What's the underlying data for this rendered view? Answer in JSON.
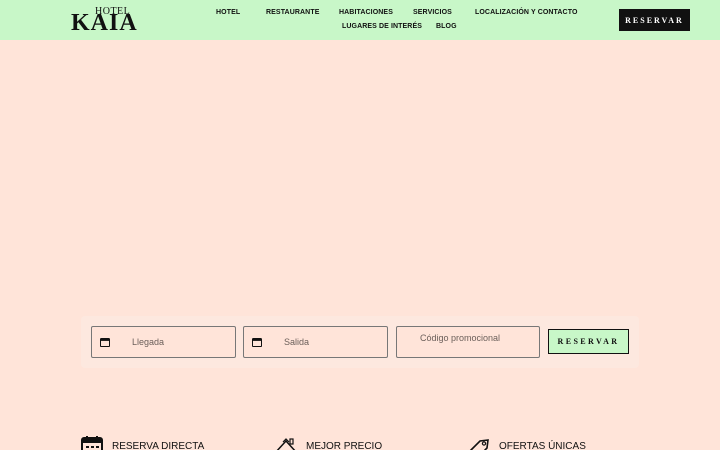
{
  "header": {
    "logo": {
      "small": "HOTEL",
      "big": "KAIA"
    },
    "nav": [
      "HOTEL",
      "RESTAURANTE",
      "HABITACIONES",
      "SERVICIOS",
      "LOCALIZACIÓN Y CONTACTO",
      "LUGARES DE INTERÉS",
      "BLOG"
    ],
    "reserve_label": "RESERVAR"
  },
  "booking": {
    "arrival_label": "Llegada",
    "departure_label": "Salida",
    "promo_placeholder": "Código promocional",
    "reserve_label": "RESERVAR"
  },
  "features": [
    {
      "icon": "calendar-icon",
      "label": "RESERVA DIRECTA"
    },
    {
      "icon": "house-icon",
      "label": "MEJOR PRECIO"
    },
    {
      "icon": "tag-icon",
      "label": "OFERTAS ÚNICAS"
    }
  ],
  "colors": {
    "header_bg": "#c8f7c8",
    "page_bg": "#ffe4d9",
    "accent_dark": "#111111"
  }
}
